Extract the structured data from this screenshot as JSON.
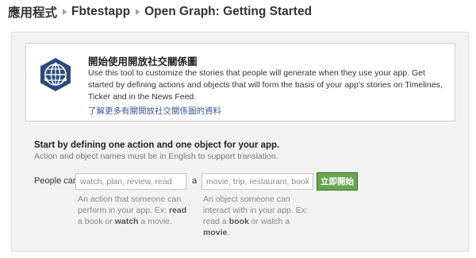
{
  "breadcrumb": {
    "apps": "應用程式",
    "app_name": "Fbtestapp",
    "page": "Open Graph: Getting Started"
  },
  "info": {
    "icon": "open-graph-globe-icon",
    "title": "開始使用開放社交關係圖",
    "description": "Use this tool to customize the stories that people will generate when they use your app. Get started by defining actions and objects that will form the basis of your app's stories on Timelines, Ticker and in the News Feed.",
    "learn_more_link": "了解更多有關開放社交關係圖的資料"
  },
  "start": {
    "title": "Start by defining one action and one object for your app.",
    "subtitle": "Action and object names must be in English to support translation."
  },
  "form": {
    "people_can_label": "People can",
    "action_placeholder": "watch, plan, review, read",
    "a_label": "a",
    "object_placeholder": "movie, trip, restaurant, book",
    "start_button": "立即開始",
    "action_hint": {
      "part1": "An action that someone can perform in your app. Ex: ",
      "bold1": "read",
      "part2": " a book or ",
      "bold2": "watch",
      "part3": " a movie."
    },
    "object_hint": {
      "part1": "An object someone can interact with in your app. Ex: read a ",
      "bold1": "book",
      "part2": " or watch a ",
      "bold2": "movie",
      "part3": "."
    }
  },
  "colors": {
    "link": "#3b5998",
    "button": "#69a74e",
    "icon": "#2d4a7a"
  }
}
